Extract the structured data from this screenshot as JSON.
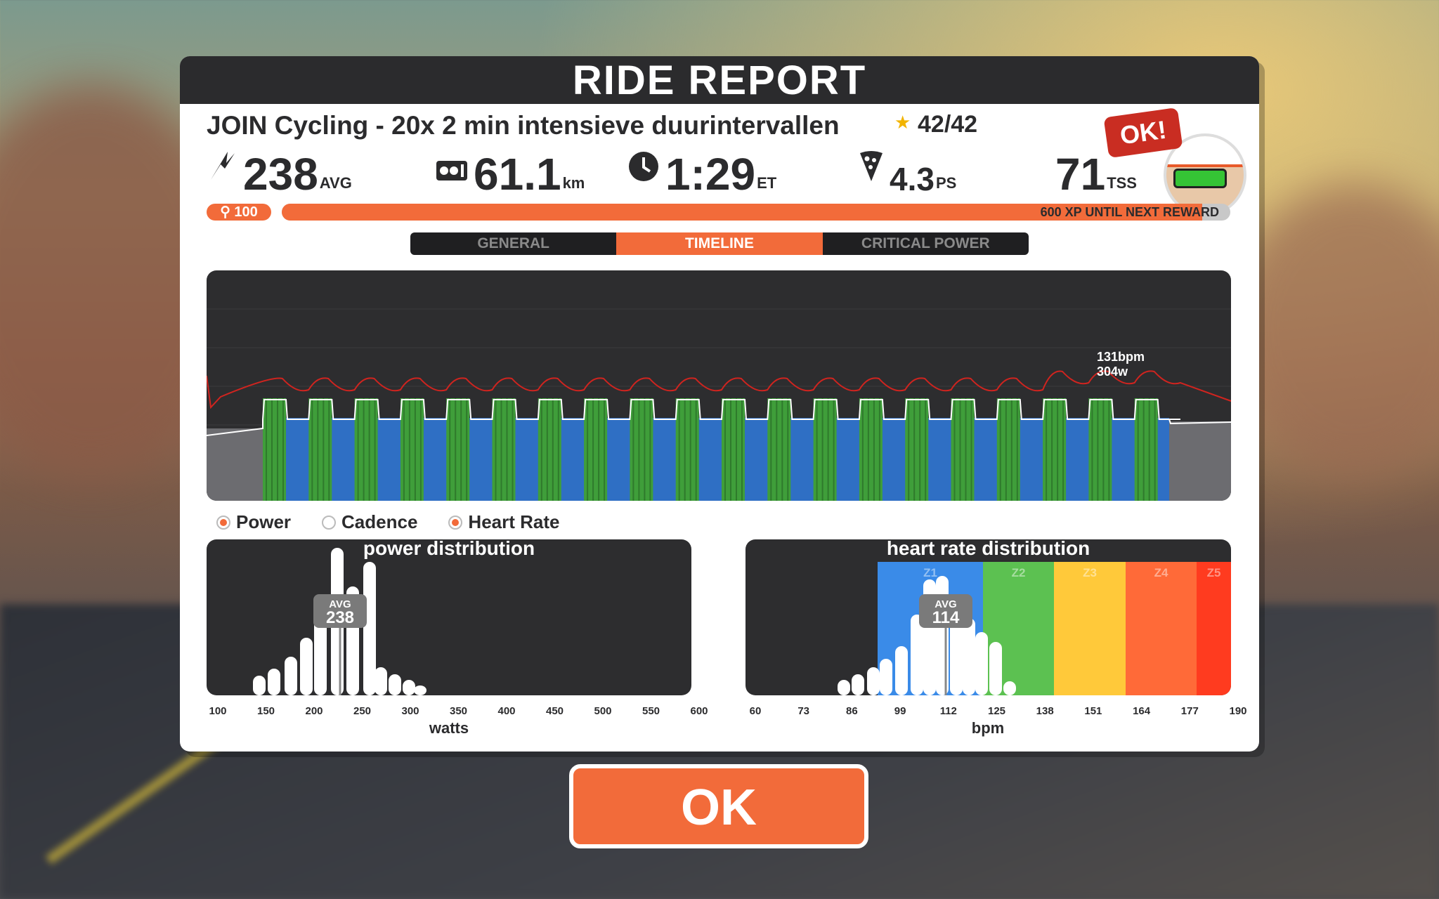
{
  "panel": {
    "title": "RIDE REPORT",
    "workout_title": "JOIN Cycling - 20x 2 min intensieve duurintervallen",
    "progress": "42/42"
  },
  "stats": [
    {
      "icon": "lightning-icon",
      "value": "238",
      "unit": "AVG"
    },
    {
      "icon": "distance-icon",
      "value": "61.1",
      "unit": "km"
    },
    {
      "icon": "clock-icon",
      "value": "1:29",
      "unit": "ET"
    },
    {
      "icon": "pizza-icon",
      "value": "4.3",
      "unit": "PS"
    },
    {
      "icon": "",
      "value": "71",
      "unit": "TSS"
    }
  ],
  "avatar": {
    "bubble": "OK!"
  },
  "level": {
    "value": "100",
    "xp_fill": 0.97,
    "xp_text": "600 XP UNTIL NEXT REWARD"
  },
  "tabs": [
    {
      "label": "GENERAL",
      "active": false
    },
    {
      "label": "TIMELINE",
      "active": true
    },
    {
      "label": "CRITICAL POWER",
      "active": false
    }
  ],
  "timeline": {
    "hover_hr": "131bpm",
    "hover_power": "304w"
  },
  "legend": [
    {
      "label": "Power",
      "selected": true
    },
    {
      "label": "Cadence",
      "selected": false
    },
    {
      "label": "Heart Rate",
      "selected": true
    }
  ],
  "colors": {
    "accent": "#f26b3a",
    "power_fill": "#2f6fc4",
    "interval_fill": "#3f9e3a",
    "hr_line": "#d0241f",
    "z1": "#3a8be8",
    "z2": "#5cc151",
    "z3": "#ffc93a",
    "z4": "#ff6a38",
    "z5": "#ff3b1f"
  },
  "power_distribution": {
    "title": "power distribution",
    "avg_label": "AVG",
    "avg_value": "238",
    "axis_title": "watts",
    "ticks": [
      "100",
      "150",
      "200",
      "250",
      "300",
      "350",
      "400",
      "450",
      "500",
      "550",
      "600"
    ]
  },
  "hr_distribution": {
    "title": "heart rate distribution",
    "avg_label": "AVG",
    "avg_value": "114",
    "axis_title": "bpm",
    "zones": [
      "Z1",
      "Z2",
      "Z3",
      "Z4",
      "Z5"
    ],
    "ticks": [
      "60",
      "73",
      "86",
      "99",
      "112",
      "125",
      "138",
      "151",
      "164",
      "177",
      "190"
    ]
  },
  "ok_button": {
    "label": "OK"
  }
}
